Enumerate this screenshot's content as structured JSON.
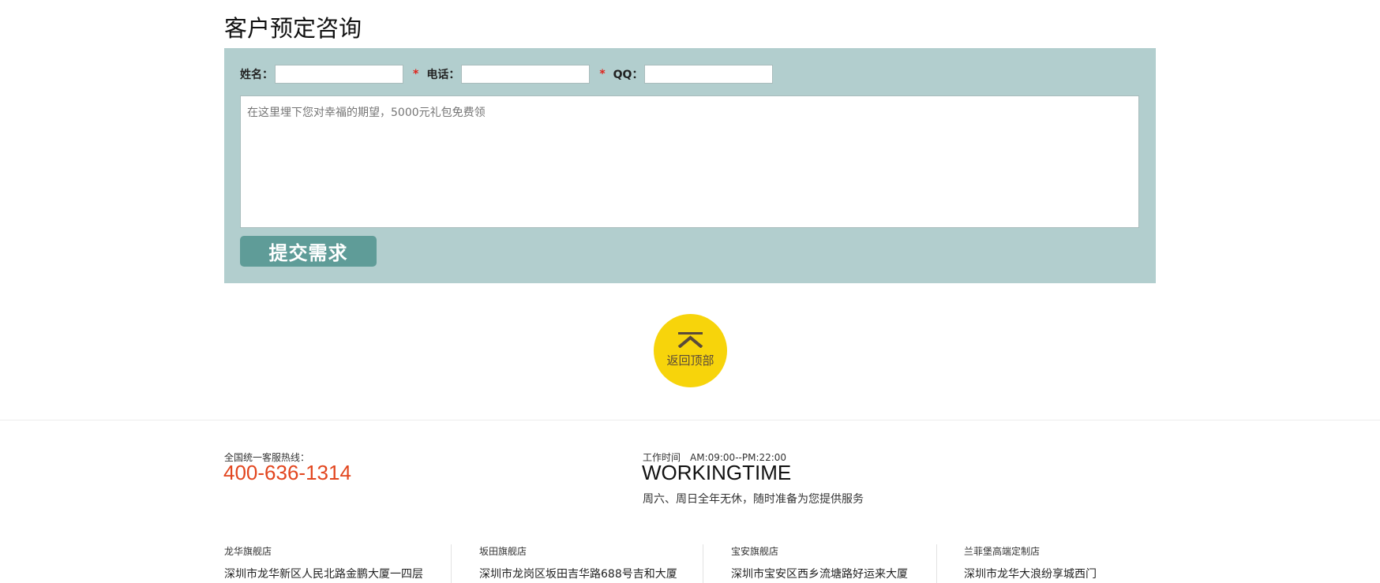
{
  "form": {
    "title": "客户预定咨询",
    "name_label": "姓名：",
    "phone_label": "电话：",
    "qq_label": "QQ：",
    "required_mark": "*",
    "message_placeholder": "在这里埋下您对幸福的期望，5000元礼包免费领",
    "submit_label": "提交需求"
  },
  "back_to_top": {
    "label": "返回顶部"
  },
  "footer": {
    "hotline_label": "全国统一客服热线：",
    "hotline": "400-636-1314",
    "hours_label": "工作时间　AM:09:00--PM:22:00",
    "working_title": "WORKINGTIME",
    "working_desc": "周六、周日全年无休，随时准备为您提供服务",
    "stores": [
      {
        "name": "龙华旗舰店",
        "address": "深圳市龙华新区人民北路金鹏大厦一四层"
      },
      {
        "name": "坂田旗舰店",
        "address": "深圳市龙岗区坂田吉华路688号吉和大厦"
      },
      {
        "name": "宝安旗舰店",
        "address": "深圳市宝安区西乡流塘路好运来大厦"
      },
      {
        "name": "兰菲堡高端定制店",
        "address": "深圳市龙华大浪纷享城西门"
      }
    ]
  },
  "colors": {
    "panel_bg": "#b2cece",
    "submit_bg": "#5f9c98",
    "backtop_bg": "#f7d40b",
    "hotline": "#e2461f",
    "required": "#e0231b"
  }
}
